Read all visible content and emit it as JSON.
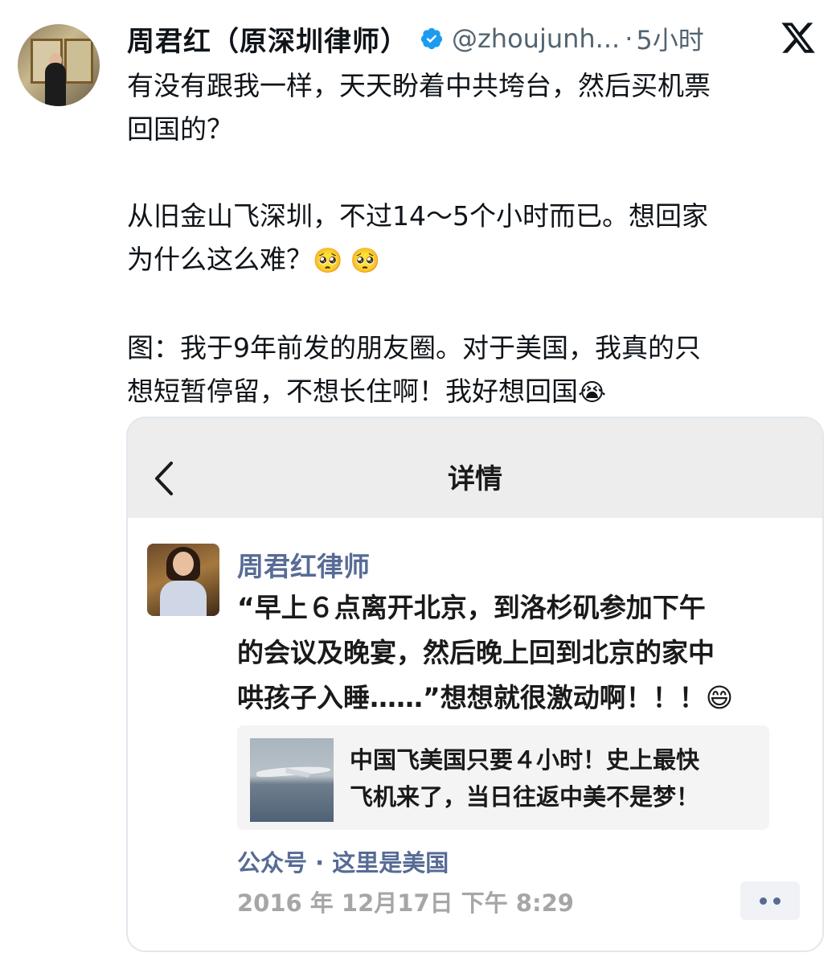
{
  "tweet": {
    "display_name": "周君红（原深圳律师）",
    "handle": "@zhoujunh...",
    "separator": "·",
    "time": "5小时",
    "text_lines": [
      "有没有跟我一样，天天盼着中共垮台，然后买机票",
      "回国的？",
      "从旧金山飞深圳，不过14～5个小时而已。想回家",
      "为什么这么难？",
      "图：我于9年前发的朋友圈。对于美国，我真的只",
      "想短暂停留，不想长住啊！我好想回国"
    ],
    "emoji_pleading": "🥺 🥺",
    "emoji_crying": "😭",
    "icons": {
      "verified": "verified-badge-icon",
      "x_logo": "x-logo-icon"
    },
    "accent_color": "#1d9bf0"
  },
  "screenshot_card": {
    "page_title": "详情",
    "back_icon": "chevron-left-icon",
    "moment": {
      "author": "周君红律师",
      "text_lines": [
        "“早上６点离开北京，到洛杉矶参加下午",
        "的会议及晚宴，然后晚上回到北京的家中",
        "哄孩子入睡……”想想就很激动啊！！！"
      ],
      "emoji_grin": "😄",
      "link_title_lines": [
        "中国飞美国只要４小时！史上最快",
        "飞机来了，当日往返中美不是梦！"
      ],
      "source": "公众号 · 这里是美国",
      "date": "2016 年 12月17日 下午 8:29",
      "more_icon": "more-dots-icon"
    },
    "link_color": "#576b95"
  }
}
